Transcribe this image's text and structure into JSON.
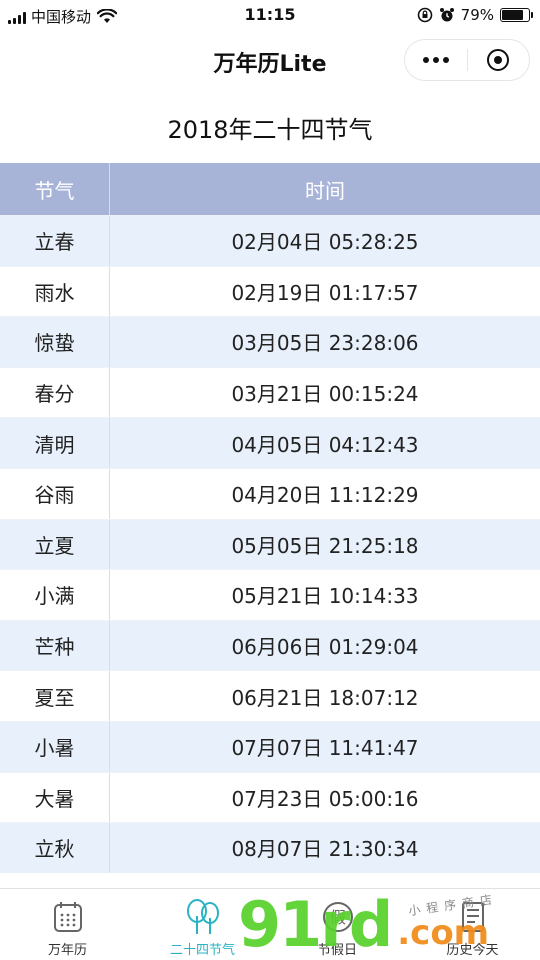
{
  "status_bar": {
    "carrier": "中国移动",
    "time": "11:15",
    "battery_percent": "79%",
    "battery_level": 0.79
  },
  "nav": {
    "title": "万年历Lite"
  },
  "page": {
    "heading": "2018年二十四节气"
  },
  "table": {
    "headers": [
      "节气",
      "时间"
    ],
    "rows": [
      {
        "term": "立春",
        "time": "02月04日 05:28:25"
      },
      {
        "term": "雨水",
        "time": "02月19日 01:17:57"
      },
      {
        "term": "惊蛰",
        "time": "03月05日 23:28:06"
      },
      {
        "term": "春分",
        "time": "03月21日 00:15:24"
      },
      {
        "term": "清明",
        "time": "04月05日 04:12:43"
      },
      {
        "term": "谷雨",
        "time": "04月20日 11:12:29"
      },
      {
        "term": "立夏",
        "time": "05月05日 21:25:18"
      },
      {
        "term": "小满",
        "time": "05月21日 10:14:33"
      },
      {
        "term": "芒种",
        "time": "06月06日 01:29:04"
      },
      {
        "term": "夏至",
        "time": "06月21日 18:07:12"
      },
      {
        "term": "小暑",
        "time": "07月07日 11:41:47"
      },
      {
        "term": "大暑",
        "time": "07月23日 05:00:16"
      },
      {
        "term": "立秋",
        "time": "08月07日 21:30:34"
      }
    ]
  },
  "tabs": [
    {
      "label": "万年历",
      "icon": "calendar-icon"
    },
    {
      "label": "二十四节气",
      "icon": "trees-icon",
      "active": true
    },
    {
      "label": "节假日",
      "icon": "holiday-icon"
    },
    {
      "label": "历史今天",
      "icon": "book-icon"
    }
  ],
  "watermark": {
    "main": "91rd",
    "suffix": ".com",
    "handwriting": "小程序商店"
  },
  "colors": {
    "header_bg": "#a8b3d8",
    "row_alt_bg": "#e8f1fb",
    "accent": "#2bb3c4"
  }
}
